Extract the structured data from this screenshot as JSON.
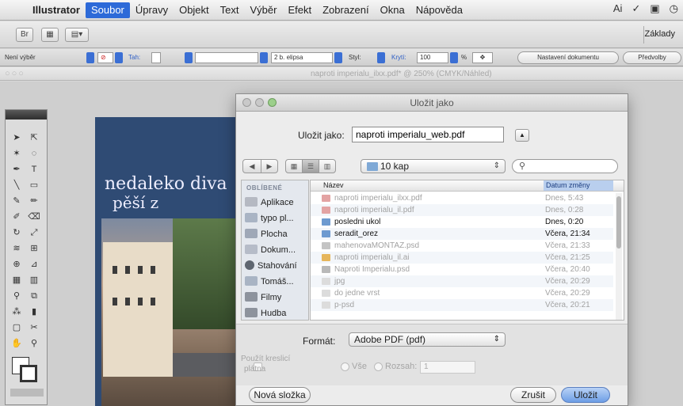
{
  "menubar": {
    "app_name": "Illustrator",
    "items": [
      "Soubor",
      "Úpravy",
      "Objekt",
      "Text",
      "Výběr",
      "Efekt",
      "Zobrazení",
      "Okna",
      "Nápověda"
    ],
    "active_item": "Soubor"
  },
  "appbar": {
    "workspace": "Základy"
  },
  "controlbar": {
    "selection_status": "Není výběr",
    "stroke_label": "Tah:",
    "brush_value": "2 b. elipsa",
    "style_label": "Styl:",
    "opacity_label": "Krytí:",
    "opacity_value": "100",
    "opacity_unit": "%",
    "doc_setup_button": "Nastavení dokumentu",
    "preferences_button": "Předvolby"
  },
  "document": {
    "title": "naproti imperialu_ilxx.pdf* @ 250% (CMYK/Náhled)"
  },
  "artboard": {
    "line1": "nedaleko diva",
    "line2": "pěší z"
  },
  "dialog": {
    "title": "Uložit jako",
    "save_as_label": "Uložit jako:",
    "filename": "naproti imperialu_web.pdf",
    "location": "10 kap",
    "search_placeholder": "",
    "sidebar_header": "OBLÍBENÉ",
    "sidebar_items": [
      {
        "label": "Aplikace",
        "icon": "applications-icon"
      },
      {
        "label": "typo pl...",
        "icon": "folder-icon"
      },
      {
        "label": "Plocha",
        "icon": "desktop-icon"
      },
      {
        "label": "Dokum...",
        "icon": "documents-icon"
      },
      {
        "label": "Stahování",
        "icon": "downloads-icon"
      },
      {
        "label": "Tomáš...",
        "icon": "home-folder-icon"
      },
      {
        "label": "Filmy",
        "icon": "movies-icon"
      },
      {
        "label": "Hudba",
        "icon": "music-icon"
      }
    ],
    "columns": {
      "name": "Název",
      "date": "Datum změny"
    },
    "files": [
      {
        "name": "naproti imperialu_ilxx.pdf",
        "date": "Dnes, 5:43",
        "icon": "pdf-file-icon",
        "enabled": false
      },
      {
        "name": "naproti imperialu_il.pdf",
        "date": "Dnes, 0:28",
        "icon": "pdf-file-icon",
        "enabled": false
      },
      {
        "name": "posledni ukol",
        "date": "Dnes, 0:20",
        "icon": "folder-icon",
        "enabled": true
      },
      {
        "name": "seradit_orez",
        "date": "Včera, 21:34",
        "icon": "folder-icon",
        "enabled": true
      },
      {
        "name": "mahenovaMONTAZ.psd",
        "date": "Včera, 21:33",
        "icon": "psd-file-icon",
        "enabled": false
      },
      {
        "name": "naproti imperialu_il.ai",
        "date": "Včera, 21:25",
        "icon": "ai-file-icon",
        "enabled": false
      },
      {
        "name": "Naproti Imperialu.psd",
        "date": "Včera, 20:40",
        "icon": "psd-file-icon",
        "enabled": false
      },
      {
        "name": "jpg",
        "date": "Včera, 20:29",
        "icon": "file-icon",
        "enabled": false
      },
      {
        "name": "do jedne vrst",
        "date": "Včera, 20:29",
        "icon": "file-icon",
        "enabled": false
      },
      {
        "name": "p-psd",
        "date": "Včera, 20:21",
        "icon": "file-icon",
        "enabled": false
      }
    ],
    "format_label": "Formát:",
    "format_value": "Adobe PDF (pdf)",
    "use_artboards_line1": "Použít kreslicí",
    "use_artboards_line2": "plátna",
    "all_label": "Vše",
    "range_label": "Rozsah:",
    "range_value": "1",
    "new_folder_button": "Nová složka",
    "cancel_button": "Zrušit",
    "save_button": "Uložit"
  }
}
